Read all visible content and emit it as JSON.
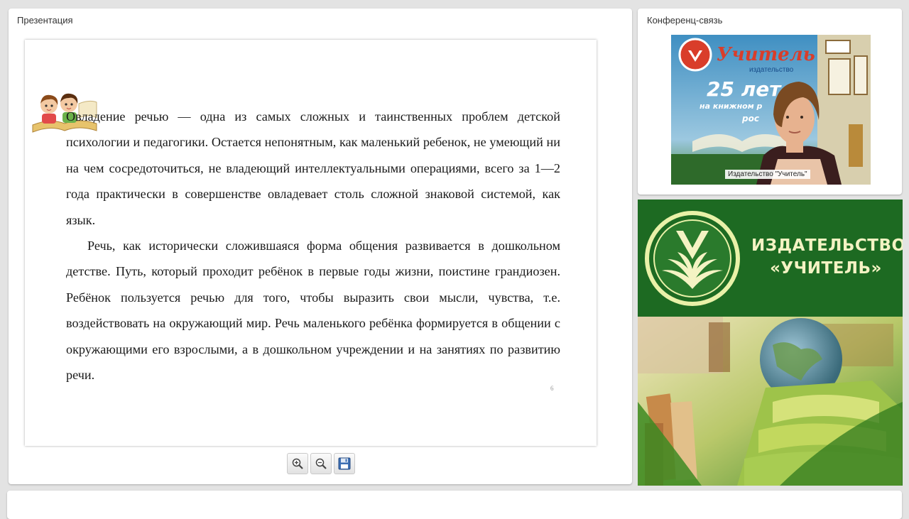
{
  "presentation": {
    "title": "Презентация",
    "slide": {
      "paragraph1": "Овладение речью — одна из самых сложных и таинственных проблем детской психологии и педагогики. Остается непонятным, как маленький ребенок, не умеющий ни на чем сосредоточиться, не владеющий интеллектуальными операциями, всего за 1—2 года практически в совершенстве овладевает столь сложной знаковой системой, как язык.",
      "paragraph2": "Речь, как исторически сложившаяся форма общения развивается в дошкольном детстве. Путь, который проходит ребёнок в первые годы жизни, поистине грандиозен. Ребёнок пользуется речью для того, чтобы выразить свои мысли, чувства, т.е. воздействовать на окружающий мир. Речь маленького ребёнка формируется в общении с окружающими его взрослыми, а в дошкольном учреждении и на занятиях по развитию речи.",
      "page_number": "6"
    },
    "toolbar": [
      {
        "name": "zoom-in-icon"
      },
      {
        "name": "zoom-out-icon"
      },
      {
        "name": "save-icon"
      }
    ]
  },
  "conference": {
    "title": "Конференц-связь",
    "video_caption": "Издательство \"Учитель\"",
    "banner": {
      "brand": "Учитель",
      "sub": "издательство",
      "years": "25 лет",
      "line": "на книжном р",
      "line2": "рос"
    }
  },
  "brand": {
    "line1": "ИЗДАТЕЛЬСТВО",
    "line2": "«УЧИТЕЛЬ»",
    "colors": {
      "green": "#1d6a22",
      "text": "#f4f3c3"
    }
  }
}
